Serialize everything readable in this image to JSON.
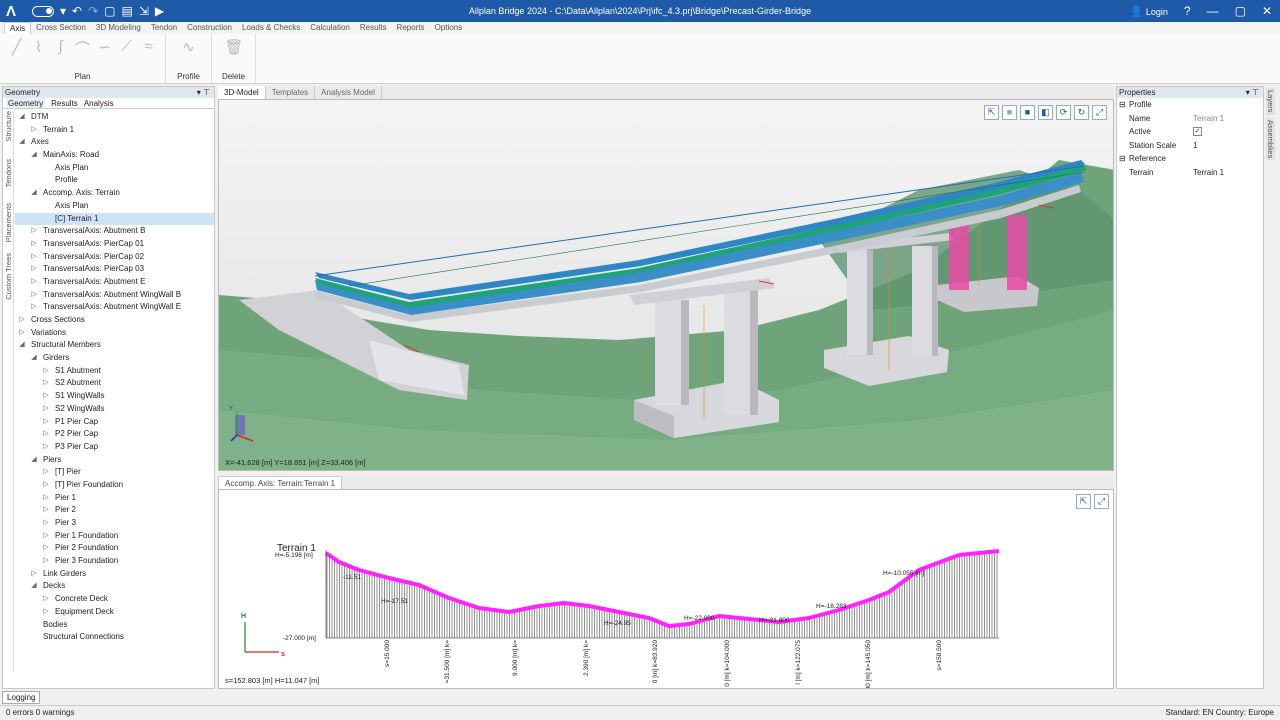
{
  "app": {
    "title": "Allplan Bridge 2024 - C:\\Data\\Allplan\\2024\\Prj\\ifc_4.3.prj\\Bridge\\Precast-Girder-Bridge",
    "logo": "Λ",
    "login_label": "Login"
  },
  "ribbon": {
    "tabs": [
      "Axis",
      "Cross Section",
      "3D Modeling",
      "Tendon",
      "Construction",
      "Loads & Checks",
      "Calculation",
      "Results",
      "Reports",
      "Options"
    ],
    "active_tab": "Axis",
    "groups": {
      "plan_label": "Plan",
      "profile_label": "Profile",
      "delete_label": "Delete"
    }
  },
  "left_panel": {
    "title": "Geometry",
    "subtabs": [
      "Geometry",
      "Results",
      "Analysis"
    ],
    "vertical_tabs": [
      "Structure",
      "Tendons",
      "Placements",
      "Custom Trees"
    ],
    "tree": [
      {
        "label": "DTM",
        "level": 0,
        "arrow": "expanded"
      },
      {
        "label": "Terrain 1",
        "level": 1,
        "arrow": "collapsed"
      },
      {
        "label": "Axes",
        "level": 0,
        "arrow": "expanded"
      },
      {
        "label": "MainAxis: Road",
        "level": 1,
        "arrow": "expanded"
      },
      {
        "label": "Axis Plan",
        "level": 2,
        "arrow": ""
      },
      {
        "label": "Profile",
        "level": 2,
        "arrow": ""
      },
      {
        "label": "Accomp. Axis: Terrain",
        "level": 1,
        "arrow": "expanded"
      },
      {
        "label": "Axis Plan",
        "level": 2,
        "arrow": ""
      },
      {
        "label": "[C] Terrain 1",
        "level": 2,
        "arrow": "",
        "selected": true
      },
      {
        "label": "TransversalAxis: Abutment B",
        "level": 1,
        "arrow": "collapsed"
      },
      {
        "label": "TransversalAxis: PierCap 01",
        "level": 1,
        "arrow": "collapsed"
      },
      {
        "label": "TransversalAxis: PierCap 02",
        "level": 1,
        "arrow": "collapsed"
      },
      {
        "label": "TransversalAxis: PierCap 03",
        "level": 1,
        "arrow": "collapsed"
      },
      {
        "label": "TransversalAxis: Abutment E",
        "level": 1,
        "arrow": "collapsed"
      },
      {
        "label": "TransversalAxis: Abutment WingWall B",
        "level": 1,
        "arrow": "collapsed"
      },
      {
        "label": "TransversalAxis: Abutment WingWall E",
        "level": 1,
        "arrow": "collapsed"
      },
      {
        "label": "Cross Sections",
        "level": 0,
        "arrow": "collapsed"
      },
      {
        "label": "Variations",
        "level": 0,
        "arrow": "collapsed"
      },
      {
        "label": "Structural Members",
        "level": 0,
        "arrow": "expanded"
      },
      {
        "label": "Girders",
        "level": 1,
        "arrow": "expanded"
      },
      {
        "label": "S1 Abutment",
        "level": 2,
        "arrow": "collapsed"
      },
      {
        "label": "S2 Abutment",
        "level": 2,
        "arrow": "collapsed"
      },
      {
        "label": "S1 WingWalls",
        "level": 2,
        "arrow": "collapsed"
      },
      {
        "label": "S2 WingWalls",
        "level": 2,
        "arrow": "collapsed"
      },
      {
        "label": "P1 Pier Cap",
        "level": 2,
        "arrow": "collapsed"
      },
      {
        "label": "P2 Pier Cap",
        "level": 2,
        "arrow": "collapsed"
      },
      {
        "label": "P3 Pier Cap",
        "level": 2,
        "arrow": "collapsed"
      },
      {
        "label": "Piers",
        "level": 1,
        "arrow": "expanded"
      },
      {
        "label": "[T] Pier",
        "level": 2,
        "arrow": "collapsed"
      },
      {
        "label": "[T] Pier Foundation",
        "level": 2,
        "arrow": "collapsed"
      },
      {
        "label": "Pier 1",
        "level": 2,
        "arrow": "collapsed"
      },
      {
        "label": "Pier 2",
        "level": 2,
        "arrow": "collapsed"
      },
      {
        "label": "Pier 3",
        "level": 2,
        "arrow": "collapsed"
      },
      {
        "label": "Pier 1 Foundation",
        "level": 2,
        "arrow": "collapsed"
      },
      {
        "label": "Pier 2 Foundation",
        "level": 2,
        "arrow": "collapsed"
      },
      {
        "label": "Pier 3 Foundation",
        "level": 2,
        "arrow": "collapsed"
      },
      {
        "label": "Link Girders",
        "level": 1,
        "arrow": "collapsed"
      },
      {
        "label": "Decks",
        "level": 1,
        "arrow": "expanded"
      },
      {
        "label": "Concrete Deck",
        "level": 2,
        "arrow": "collapsed"
      },
      {
        "label": "Equipment Deck",
        "level": 2,
        "arrow": "collapsed"
      },
      {
        "label": "Bodies",
        "level": 1,
        "arrow": ""
      },
      {
        "label": "Structural Connections",
        "level": 1,
        "arrow": ""
      }
    ]
  },
  "view_tabs": [
    "3D-Model",
    "Templates",
    "Analysis Model"
  ],
  "view3d": {
    "coords": "X=-41.628 [m] Y=18.651 [m] Z=33.406 [m]",
    "axis_y_label": "Y"
  },
  "section_view": {
    "tab_label": "Accomp. Axis: Terrain:Terrain 1",
    "title": "Terrain 1",
    "height_label": "H=-5.198 [m]",
    "base_label": "-27.000 [m]",
    "axis_h": "H",
    "axis_s": "s",
    "labels_h": [
      "-11.51",
      "H=-17.51",
      "H=-10.055 [m]",
      "H=-18.283",
      "H=-22.000",
      "H=-21.800",
      "H=-24.95"
    ],
    "labels_s": [
      "s=15.000",
      "=31.500 [m] k=",
      "9.000 [m] k=",
      "2.390 [m] k=",
      "0 [m] k=83.920",
      "0 [m] k=104.000",
      "l [m] k=122.075",
      "500 [m] k=145.050",
      "s=158.500"
    ],
    "coords": "s=152.803 [m] H=11.047 [m]"
  },
  "properties": {
    "title": "Properties",
    "groups": [
      {
        "name": "Profile",
        "rows": [
          {
            "key": "Name",
            "value": "Terrain 1",
            "muted": true
          },
          {
            "key": "Active",
            "value": "✓"
          },
          {
            "key": "Station Scale",
            "value": "1"
          }
        ]
      },
      {
        "name": "Reference",
        "rows": [
          {
            "key": "Terrain",
            "value": "Terrain 1"
          }
        ]
      }
    ],
    "side_tabs": [
      "Layers",
      "Assemblies"
    ]
  },
  "logging_tab": "Logging",
  "status": {
    "left": "0 errors 0 warnings",
    "right": "Standard: EN Country: Europe"
  },
  "colors": {
    "title_bar": "#1e5aa8",
    "deck_green": "#1fa37a",
    "deck_blue": "#3a8fc8",
    "terrain_green": "#6fa37a",
    "profile_magenta": "#ff22ff",
    "pier_pink": "#e84aa6"
  }
}
